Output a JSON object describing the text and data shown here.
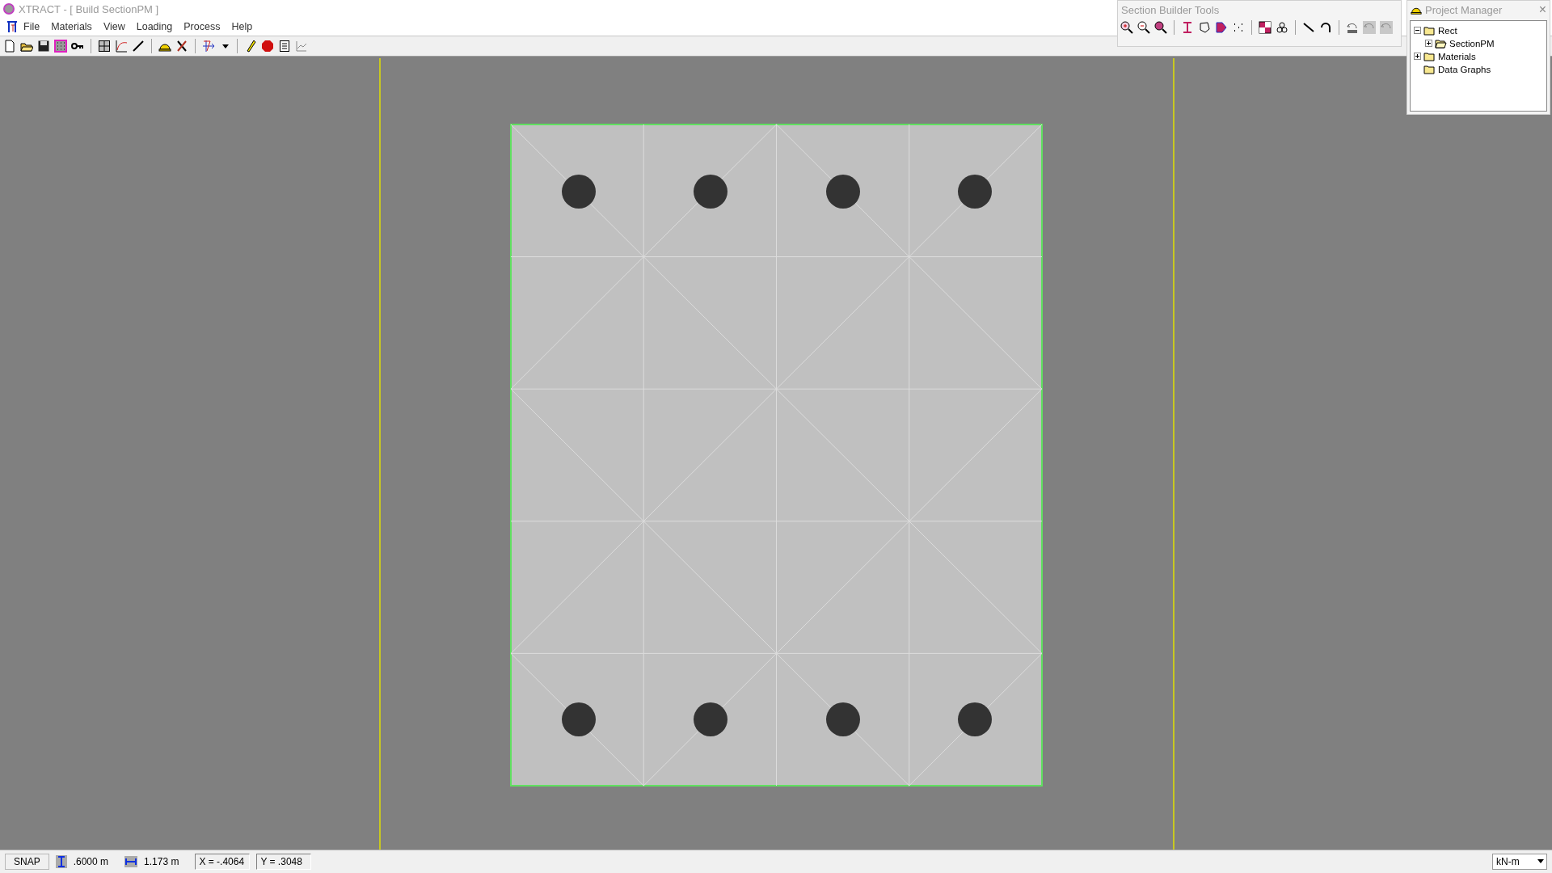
{
  "window": {
    "title": "XTRACT - [ Build SectionPM ]"
  },
  "menu": [
    {
      "label": "File"
    },
    {
      "label": "Materials"
    },
    {
      "label": "View"
    },
    {
      "label": "Loading"
    },
    {
      "label": "Process"
    },
    {
      "label": "Help"
    }
  ],
  "section_builder_tools": {
    "title": "Section Builder Tools"
  },
  "project_manager": {
    "title": "Project Manager",
    "close": "×",
    "tree": [
      {
        "label": "Rect",
        "has_children": true,
        "expanded": true,
        "open": false,
        "children": [
          {
            "label": "SectionPM",
            "has_children": true,
            "expanded": false,
            "open": true
          }
        ]
      },
      {
        "label": "Materials",
        "has_children": true,
        "expanded": false,
        "open": false
      },
      {
        "label": "Data Graphs",
        "has_children": false,
        "open": false
      }
    ]
  },
  "status_bar": {
    "snap": "SNAP",
    "height": ".6000 m",
    "width": "1.173 m",
    "x": "X = -.4064",
    "y": "Y = .3048",
    "units": "kN-m"
  }
}
